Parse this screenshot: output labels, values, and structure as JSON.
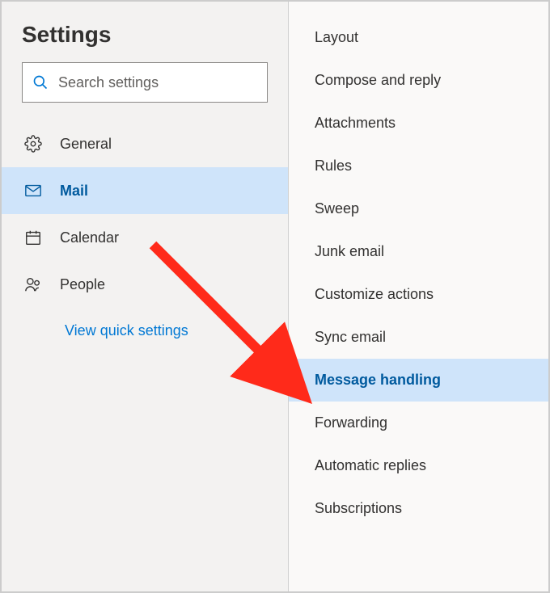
{
  "title": "Settings",
  "search": {
    "placeholder": "Search settings"
  },
  "nav": {
    "items": [
      {
        "label": "General"
      },
      {
        "label": "Mail"
      },
      {
        "label": "Calendar"
      },
      {
        "label": "People"
      }
    ]
  },
  "quick_settings_link": "View quick settings",
  "sub": {
    "items": [
      {
        "label": "Layout"
      },
      {
        "label": "Compose and reply"
      },
      {
        "label": "Attachments"
      },
      {
        "label": "Rules"
      },
      {
        "label": "Sweep"
      },
      {
        "label": "Junk email"
      },
      {
        "label": "Customize actions"
      },
      {
        "label": "Sync email"
      },
      {
        "label": "Message handling"
      },
      {
        "label": "Forwarding"
      },
      {
        "label": "Automatic replies"
      },
      {
        "label": "Subscriptions"
      }
    ]
  }
}
